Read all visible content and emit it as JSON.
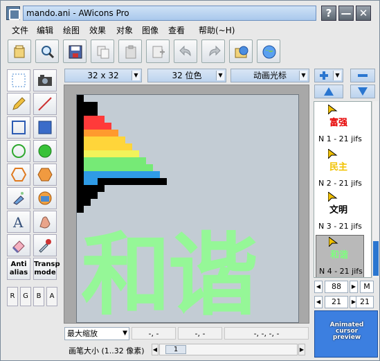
{
  "window": {
    "title": "mando.ani - AWicons Pro",
    "buttons": {
      "help": "?",
      "minimize": "—",
      "close": "✕"
    }
  },
  "menu": [
    "文件",
    "编辑",
    "绘图",
    "效果",
    "对象",
    "图像",
    "查看",
    "帮助(~H)"
  ],
  "toolbar_icons": [
    "open-icon",
    "search-icon",
    "save-icon",
    "copy-icon",
    "paste-icon",
    "new-frame-icon",
    "undo-icon",
    "redo-icon",
    "cursor-folder-icon",
    "globe-icon"
  ],
  "selectors": {
    "size": "32 x 32",
    "depth": "32 位色",
    "type": "动画光标"
  },
  "left_tools": {
    "antialias": "Anti\nalias",
    "transp_mode": "Transp\nmode",
    "channels": [
      "R",
      "G",
      "B",
      "A"
    ]
  },
  "canvas_text": "和谐",
  "status": {
    "zoom": "最大缩放",
    "f1": "-, -",
    "f2": "-, -",
    "f3": "-, -, -, -"
  },
  "pen": {
    "label": "画笔大小 (1..32 像素)",
    "value": "1"
  },
  "frames": [
    {
      "name": "富强",
      "color": "#e60000",
      "label": "N 1 - 21 jifs"
    },
    {
      "name": "民主",
      "color": "#f2c200",
      "label": "N 2 - 21 jifs"
    },
    {
      "name": "文明",
      "color": "#000000",
      "label": "N 3 - 21 jifs"
    },
    {
      "name": "和谐",
      "color": "#7dff7d",
      "label": "N 4 - 21 jifs"
    }
  ],
  "counters": {
    "zoom_value": "88",
    "m_label": "M",
    "frame_rate": "21",
    "frame_rate2": "21"
  },
  "preview_text": "Animated cursor preview",
  "colors": {
    "accent": "#3c7fe0",
    "stripe_red": "#ff3a3a",
    "stripe_orange": "#ff9a2e",
    "stripe_yellow": "#ffd53a",
    "stripe_green": "#76ea76",
    "stripe_blue": "#2f9be6"
  }
}
